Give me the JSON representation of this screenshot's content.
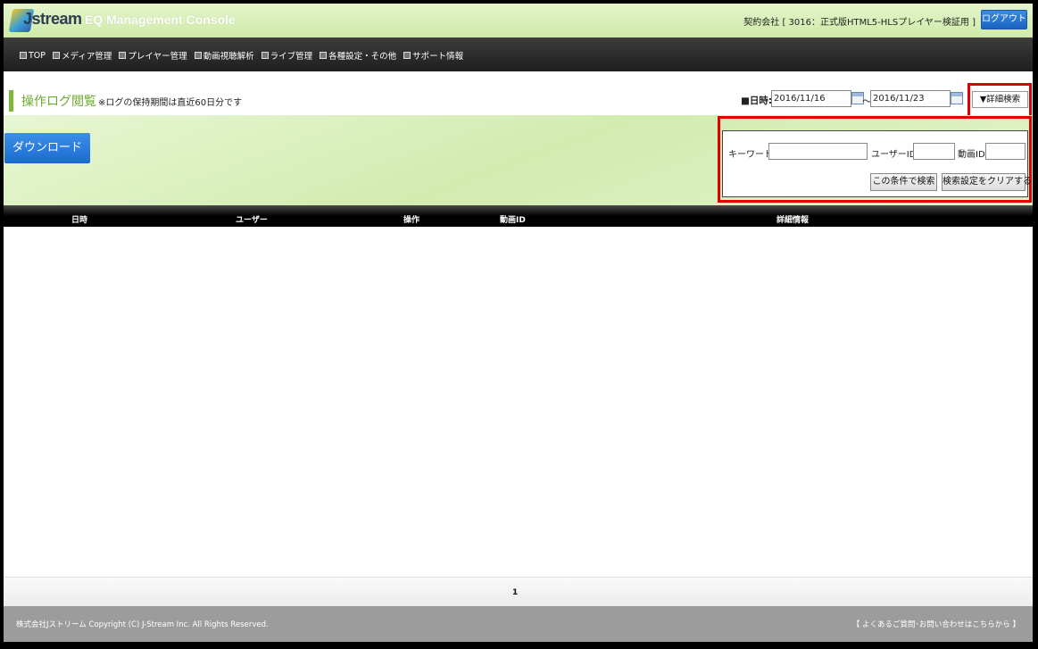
{
  "header": {
    "logo_text": "Jstream",
    "console_title": "EQ Management Console",
    "contract": "契約会社 [ 3016：正式版HTML5-HLSプレイヤー検証用 ]",
    "logout_label": "ログアウト"
  },
  "nav": {
    "items": [
      {
        "label": "TOP"
      },
      {
        "label": "メディア管理"
      },
      {
        "label": "プレイヤー管理"
      },
      {
        "label": "動画視聴解析"
      },
      {
        "label": "ライブ管理"
      },
      {
        "label": "各種設定・その他"
      },
      {
        "label": "サポート情報"
      }
    ]
  },
  "page": {
    "title": "操作ログ閲覧",
    "note": "※ログの保持期間は直近60日分です"
  },
  "date_filter": {
    "label": "■日時:",
    "from": "2016/11/16",
    "separator": "～",
    "to": "2016/11/23"
  },
  "advanced_search_label": "▼詳細検索",
  "download_label": "ダウンロード",
  "search_panel": {
    "keyword_label": "キーワード:",
    "keyword_value": "",
    "user_id_label": "ユーザーID:",
    "user_id_value": "",
    "video_id_label": "動画ID:",
    "video_id_value": "",
    "search_button": "この条件で検索",
    "clear_button": "検索設定をクリアする"
  },
  "table": {
    "columns": [
      "日時",
      "ユーザー",
      "操作",
      "動画ID",
      "詳細情報"
    ],
    "rows": []
  },
  "pagination": {
    "current_page": "1"
  },
  "footer": {
    "copyright": "株式会社Jストリーム  Copyright (C) J-Stream Inc. All Rights Reserved.",
    "faq_link": "【 よくあるご質問･お問い合わせはこちらから 】"
  },
  "colors": {
    "accent_green": "#7cb83a",
    "button_blue": "#1c6ad0",
    "highlight_red": "#e00000"
  }
}
